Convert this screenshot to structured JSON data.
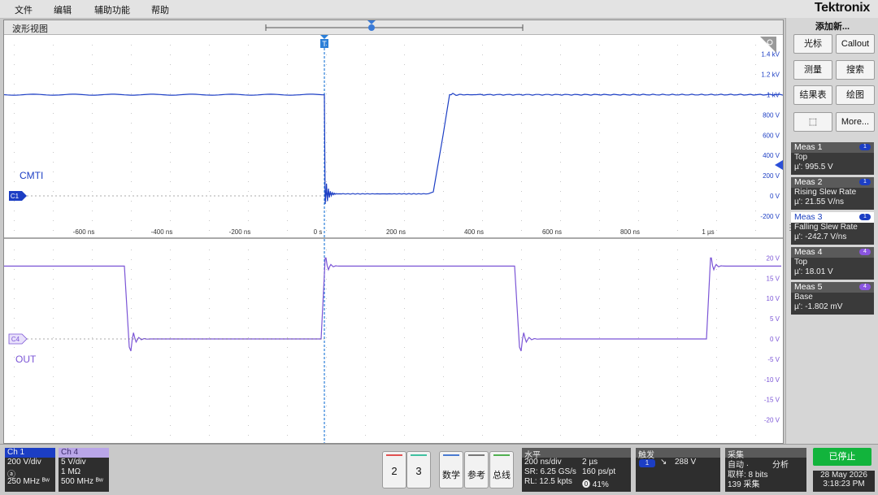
{
  "menu": [
    "文件",
    "编辑",
    "辅助功能",
    "帮助"
  ],
  "brand": "Tektronix",
  "wave": {
    "title": "波形视图",
    "trigger_marker": "T",
    "cursor_marker": "U",
    "ch1_badge": "C1",
    "ch4_badge": "C4",
    "ch1_label": "CMTI",
    "ch4_label": "OUT",
    "time_labels": [
      "-600 ns",
      "-400 ns",
      "-200 ns",
      "0 s",
      "200 ns",
      "400 ns",
      "600 ns",
      "800 ns",
      "1 µs"
    ],
    "time_values_ns": [
      -600,
      -400,
      -200,
      0,
      200,
      400,
      600,
      800,
      1000
    ],
    "top_vlabels": [
      "1.4 kV",
      "1.2 kV",
      "1 kV",
      "800 V",
      "600 V",
      "400 V",
      "200 V",
      "0 V",
      "-200 V"
    ],
    "top_vvalues": [
      1400,
      1200,
      1000,
      800,
      600,
      400,
      200,
      0,
      -200
    ],
    "bot_vlabels": [
      "20 V",
      "15 V",
      "10 V",
      "5 V",
      "0 V",
      "-5 V",
      "-10 V",
      "-15 V",
      "-20 V"
    ],
    "bot_vvalues": [
      20,
      15,
      10,
      5,
      0,
      -5,
      -10,
      -15,
      -20
    ]
  },
  "side": {
    "add_new": "添加新...",
    "buttons": [
      {
        "name": "cursor-button",
        "label": "光标"
      },
      {
        "name": "callout-button",
        "label": "Callout"
      },
      {
        "name": "measure-button",
        "label": "测量"
      },
      {
        "name": "search-button",
        "label": "搜索"
      },
      {
        "name": "results-table-button",
        "label": "结果表"
      },
      {
        "name": "plot-button",
        "label": "绘图"
      },
      {
        "name": "zoom-icon-button",
        "label": "⬚"
      },
      {
        "name": "more-button",
        "label": "More..."
      }
    ],
    "measurements": [
      {
        "name": "Meas 1",
        "type": "Top",
        "value": "µ': 995.5 V",
        "badge": "1",
        "color": "#1c3ec4"
      },
      {
        "name": "Meas 2",
        "type": "Rising Slew Rate",
        "value": "µ': 21.55 V/ns",
        "badge": "1",
        "color": "#1c3ec4"
      },
      {
        "name": "Meas 3",
        "type": "Falling Slew Rate",
        "value": "µ': -242.7 V/ns",
        "badge": "1",
        "color": "#1c3ec4"
      },
      {
        "name": "Meas 4",
        "type": "Top",
        "value": "µ': 18.01 V",
        "badge": "4",
        "color": "#8a55e0"
      },
      {
        "name": "Meas 5",
        "type": "Base",
        "value": "µ': -1.802 mV",
        "badge": "4",
        "color": "#8a55e0"
      }
    ]
  },
  "bottom": {
    "ch1": {
      "title": "Ch 1",
      "scale": "200 V/div",
      "imp": "ⓐ",
      "bw": "250 MHz ᴮʷ",
      "color": "#1c3ec4"
    },
    "ch4": {
      "title": "Ch 4",
      "scale": "5 V/div",
      "imp": "1 MΩ",
      "bw": "500 MHz ᴮʷ",
      "color": "#b9a6e8"
    },
    "buttons": [
      {
        "name": "add-ch2-button",
        "label": "2",
        "color": "#e05050"
      },
      {
        "name": "add-ch3-button",
        "label": "3",
        "color": "#40c0a0"
      },
      {
        "name": "math-button",
        "label": "数学",
        "color": "#4a7ad0"
      },
      {
        "name": "ref-button",
        "label": "参考",
        "color": "#777777"
      },
      {
        "name": "bus-button",
        "label": "总线",
        "color": "#50b050"
      }
    ],
    "horizontal": {
      "title": "水平",
      "row1a": "200 ns/div",
      "row1b": "2 µs",
      "row2a": "SR: 6.25 GS/s",
      "row2b": "160 ps/pt",
      "row3a": "RL: 12.5 kpts",
      "row3b": "⓿ 41%"
    },
    "trigger": {
      "title": "触发",
      "source": "1",
      "slope": "↘",
      "level": "288 V"
    },
    "acquire": {
      "title": "采集",
      "mode": "自动 ·",
      "analyze": "分析",
      "res": "取样: 8 bits",
      "count": "139 采集"
    },
    "status": "已停止",
    "date": "28 May 2026",
    "time": "3:18:23 PM"
  },
  "colors": {
    "ch1": "#1c3ec4",
    "ch4": "#7b55d6",
    "accent": "#12b43c"
  }
}
